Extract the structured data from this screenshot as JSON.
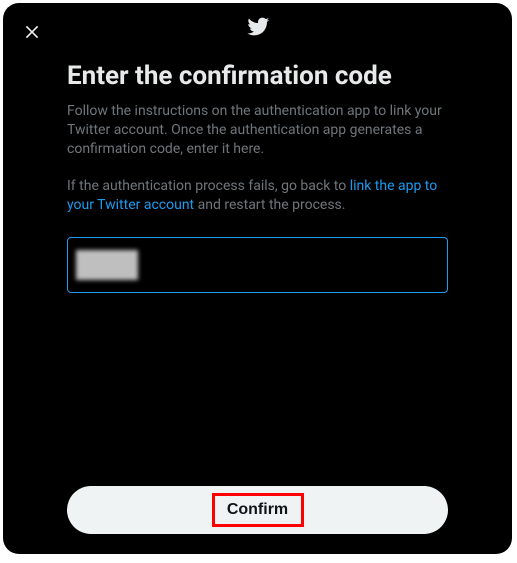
{
  "title": "Enter the confirmation code",
  "description1": "Follow the instructions on the authentication app to link your Twitter account. Once the authentication app generates a confirmation code, enter it here.",
  "description2_prefix": "If the authentication process fails, go back to ",
  "link_text": "link the app to your Twitter account",
  "description2_suffix": " and restart the process.",
  "confirm_label": "Confirm",
  "input_value": "",
  "colors": {
    "accent": "#1d9bf0",
    "background": "#000000",
    "text": "#e7e9ea",
    "muted": "#71767b",
    "button_bg": "#eff3f4",
    "button_text": "#0f1419"
  }
}
